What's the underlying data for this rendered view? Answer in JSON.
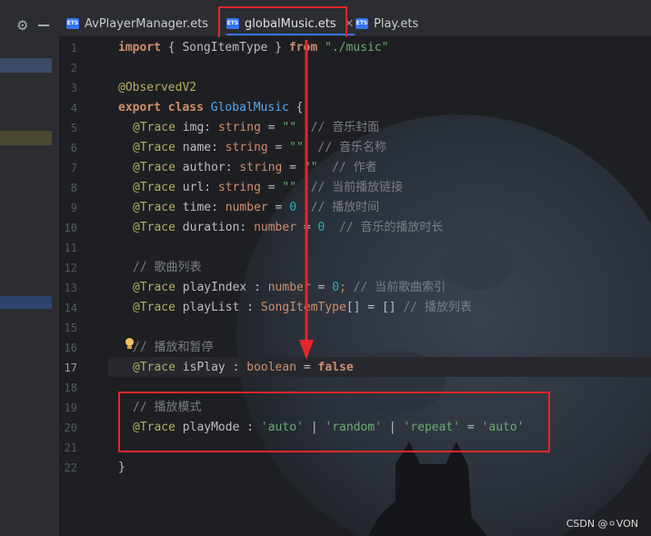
{
  "tabs": [
    {
      "icon": "ETS",
      "label": "AvPlayerManager.ets"
    },
    {
      "icon": "ETS",
      "label": "globalMusic.ets",
      "active": true
    },
    {
      "icon": "ETS",
      "label": "Play.ets"
    }
  ],
  "line_numbers": [
    "1",
    "2",
    "3",
    "4",
    "5",
    "6",
    "7",
    "8",
    "9",
    "10",
    "11",
    "12",
    "13",
    "14",
    "15",
    "16",
    "17",
    "18",
    "19",
    "20",
    "21",
    "22"
  ],
  "current_line": "17",
  "code": {
    "l1": {
      "import": "import",
      "brace_open": " { ",
      "name": "SongItemType",
      "brace_close": " } ",
      "from": "from",
      "path": " \"./music\""
    },
    "l3": {
      "decorator": "@ObservedV2"
    },
    "l4": {
      "export": "export",
      "class": " class ",
      "name": "GlobalMusic",
      "brace": " {"
    },
    "l5": {
      "trace": "@Trace",
      "field": " img",
      "colon": ": ",
      "type": "string",
      "eq": " = ",
      "val": "\"\"",
      "comment": "  // 音乐封面"
    },
    "l6": {
      "trace": "@Trace",
      "field": " name",
      "colon": ": ",
      "type": "string",
      "eq": " = ",
      "val": "\"\"",
      "comment": "  // 音乐名称"
    },
    "l7": {
      "trace": "@Trace",
      "field": " author",
      "colon": ": ",
      "type": "string",
      "eq": " = ",
      "val": "\"\"",
      "comment": "  // 作者"
    },
    "l8": {
      "trace": "@Trace",
      "field": " url",
      "colon": ": ",
      "type": "string",
      "eq": " = ",
      "val": "\"\"",
      "comment": "  // 当前播放链接"
    },
    "l9": {
      "trace": "@Trace",
      "field": " time",
      "colon": ": ",
      "type": "number",
      "eq": " = ",
      "val": "0",
      "comment": "  // 播放时间"
    },
    "l10": {
      "trace": "@Trace",
      "field": " duration",
      "colon": ": ",
      "type": "number",
      "eq": " = ",
      "val": "0",
      "comment": "  // 音乐的播放时长"
    },
    "l12": {
      "comment": "// 歌曲列表"
    },
    "l13": {
      "trace": "@Trace",
      "field": " playIndex",
      "colon": " : ",
      "type": "number",
      "eq": " = ",
      "val": "0",
      "semi": ";",
      "comment": " // 当前歌曲索引"
    },
    "l14": {
      "trace": "@Trace",
      "field": " playList",
      "colon": " : ",
      "type": "SongItemType",
      "brackets": "[]",
      "eq": " = ",
      "val": "[]",
      "comment": " // 播放列表"
    },
    "l16": {
      "comment": "// 播放和暂停"
    },
    "l17": {
      "trace": "@Trace",
      "field": " isPlay",
      "colon": " : ",
      "type": "boolean",
      "eq": " = ",
      "val": "false"
    },
    "l19": {
      "comment": "// 播放模式"
    },
    "l20": {
      "trace": "@Trace",
      "field": " playMode",
      "colon": " : ",
      "v1": "'auto'",
      "p1": " | ",
      "v2": "'random'",
      "p2": " | ",
      "v3": "'repeat'",
      "eq": " = ",
      "v4": "'auto'"
    },
    "l22": {
      "brace": "}"
    }
  },
  "watermark": "CSDN @⚪VON",
  "colors": {
    "annotation_red": "#e5262a",
    "tab_accent": "#3574f0"
  }
}
